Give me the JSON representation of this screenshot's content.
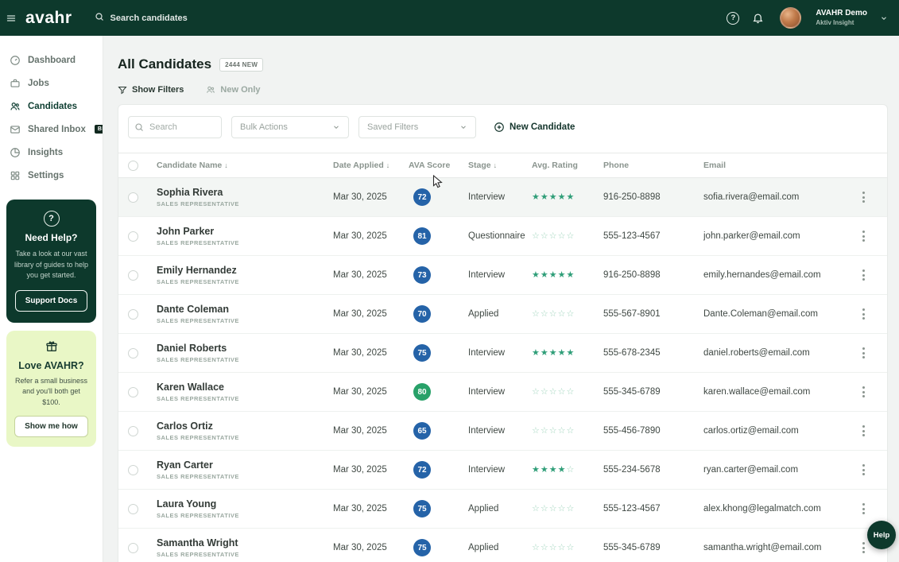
{
  "topbar": {
    "logo": "avahr",
    "search_placeholder": "Search candidates",
    "help_glyph": "?",
    "account": {
      "name": "AVAHR Demo",
      "org": "Aktiv Insight"
    }
  },
  "sidebar": {
    "items": [
      {
        "label": "Dashboard"
      },
      {
        "label": "Jobs"
      },
      {
        "label": "Candidates"
      },
      {
        "label": "Shared Inbox",
        "badge": "BETA"
      },
      {
        "label": "Insights"
      },
      {
        "label": "Settings"
      }
    ],
    "help_card": {
      "icon_glyph": "?",
      "title": "Need Help?",
      "body": "Take a look at our vast library of guides to help you get started.",
      "button": "Support Docs"
    },
    "referral_card": {
      "title": "Love AVAHR?",
      "body": "Refer a small business and you'll both get $100.",
      "button": "Show me how"
    }
  },
  "main": {
    "title": "All Candidates",
    "new_badge": "2444 NEW",
    "filters": {
      "show_filters": "Show Filters",
      "new_only": "New Only"
    },
    "toolbar": {
      "search_placeholder": "Search",
      "bulk_actions": "Bulk Actions",
      "saved_filters": "Saved Filters",
      "new_candidate": "New Candidate"
    },
    "table": {
      "sort_arrow": "↓",
      "columns": [
        {
          "label": "Candidate Name",
          "sorted": true
        },
        {
          "label": "Date Applied",
          "sorted": true
        },
        {
          "label": "AVA Score",
          "sorted": false
        },
        {
          "label": "Stage",
          "sorted": true
        },
        {
          "label": "Avg. Rating",
          "sorted": false
        },
        {
          "label": "Phone",
          "sorted": false
        },
        {
          "label": "Email",
          "sorted": false
        }
      ],
      "rows": [
        {
          "name": "Sophia Rivera",
          "role": "SALES REPRESENTATIVE",
          "date": "Mar 30, 2025",
          "score": 72,
          "score_color": "blue",
          "stage": "Interview",
          "rating": 5,
          "phone": "916-250-8898",
          "email": "sofia.rivera@email.com",
          "highlighted": true
        },
        {
          "name": "John Parker",
          "role": "SALES REPRESENTATIVE",
          "date": "Mar 30, 2025",
          "score": 81,
          "score_color": "blue",
          "stage": "Questionnaire",
          "rating": 0,
          "phone": "555-123-4567",
          "email": "john.parker@email.com",
          "highlighted": false
        },
        {
          "name": "Emily Hernandez",
          "role": "SALES REPRESENTATIVE",
          "date": "Mar 30, 2025",
          "score": 73,
          "score_color": "blue",
          "stage": "Interview",
          "rating": 5,
          "phone": "916-250-8898",
          "email": "emily.hernandes@email.com",
          "highlighted": false
        },
        {
          "name": "Dante Coleman",
          "role": "SALES REPRESENTATIVE",
          "date": "Mar 30, 2025",
          "score": 70,
          "score_color": "blue",
          "stage": "Applied",
          "rating": 0,
          "phone": "555-567-8901",
          "email": "Dante.Coleman@email.com",
          "highlighted": false
        },
        {
          "name": "Daniel Roberts",
          "role": "SALES REPRESENTATIVE",
          "date": "Mar 30, 2025",
          "score": 75,
          "score_color": "blue",
          "stage": "Interview",
          "rating": 5,
          "phone": "555-678-2345",
          "email": "daniel.roberts@email.com",
          "highlighted": false
        },
        {
          "name": "Karen Wallace",
          "role": "SALES REPRESENTATIVE",
          "date": "Mar 30, 2025",
          "score": 80,
          "score_color": "green",
          "stage": "Interview",
          "rating": 0,
          "phone": "555-345-6789",
          "email": "karen.wallace@email.com",
          "highlighted": false
        },
        {
          "name": "Carlos Ortiz",
          "role": "SALES REPRESENTATIVE",
          "date": "Mar 30, 2025",
          "score": 65,
          "score_color": "blue",
          "stage": "Interview",
          "rating": 0,
          "phone": "555-456-7890",
          "email": "carlos.ortiz@email.com",
          "highlighted": false
        },
        {
          "name": "Ryan Carter",
          "role": "SALES REPRESENTATIVE",
          "date": "Mar 30, 2025",
          "score": 72,
          "score_color": "blue",
          "stage": "Interview",
          "rating": 4,
          "phone": "555-234-5678",
          "email": "ryan.carter@email.com",
          "highlighted": false
        },
        {
          "name": "Laura Young",
          "role": "SALES REPRESENTATIVE",
          "date": "Mar 30, 2025",
          "score": 75,
          "score_color": "blue",
          "stage": "Applied",
          "rating": 0,
          "phone": "555-123-4567",
          "email": "alex.khong@legalmatch.com",
          "highlighted": false
        },
        {
          "name": "Samantha Wright",
          "role": "SALES REPRESENTATIVE",
          "date": "Mar 30, 2025",
          "score": 75,
          "score_color": "blue",
          "stage": "Applied",
          "rating": 0,
          "phone": "555-345-6789",
          "email": "samantha.wright@email.com",
          "highlighted": false
        }
      ]
    }
  },
  "fab": {
    "label": "Help"
  },
  "icons": {
    "star_filled": "★",
    "star_empty": "☆"
  },
  "colors": {
    "brand_dark": "#0d392c",
    "score_blue": "#2563a8",
    "score_green": "#28a169",
    "star_green": "#2f9e78",
    "referral_bg": "#e9f7c6"
  }
}
